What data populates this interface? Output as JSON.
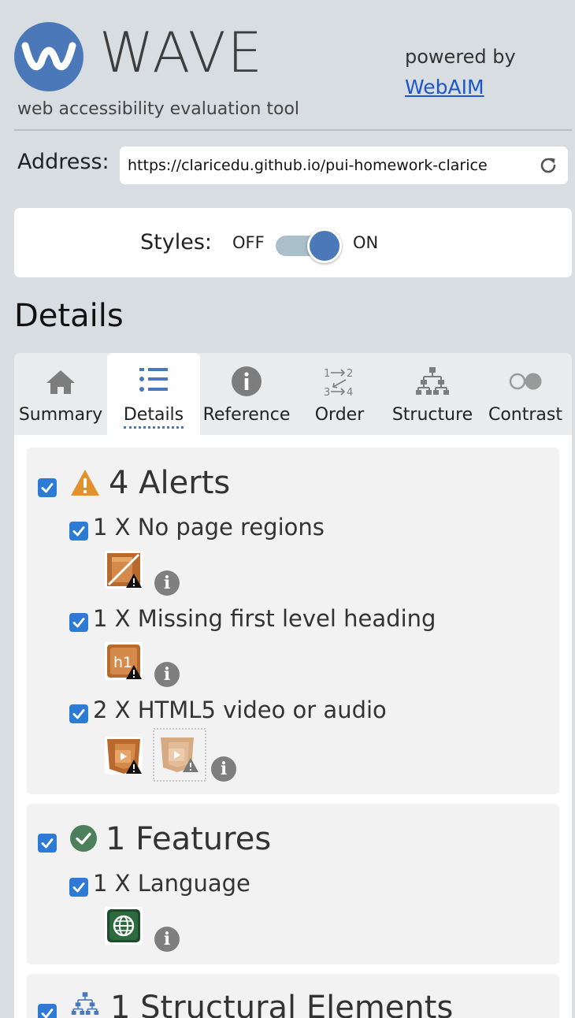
{
  "header": {
    "logo_word": "WAVE",
    "tagline": "web accessibility evaluation tool",
    "powered_by": "powered by",
    "webaim_link": "WebAIM"
  },
  "address": {
    "label": "Address:",
    "url": "https://claricedu.github.io/pui-homework-clarice"
  },
  "styles": {
    "label": "Styles:",
    "off": "OFF",
    "on": "ON",
    "state": "on"
  },
  "panel_title": "Details",
  "tabs": [
    {
      "label": "Summary",
      "icon": "home-icon"
    },
    {
      "label": "Details",
      "icon": "list-icon",
      "active": true
    },
    {
      "label": "Reference",
      "icon": "info-icon"
    },
    {
      "label": "Order",
      "icon": "order-icon"
    },
    {
      "label": "Structure",
      "icon": "structure-icon"
    },
    {
      "label": "Contrast",
      "icon": "contrast-icon"
    }
  ],
  "categories": [
    {
      "title": "4 Alerts",
      "icon": "alert-icon",
      "items": [
        {
          "label": "1 X No page regions",
          "icon": "no-regions-alert-icon"
        },
        {
          "label": "1 X Missing first level heading",
          "icon": "missing-h1-alert-icon",
          "icon_text": "h1"
        },
        {
          "label": "2 X HTML5 video or audio",
          "icon": "html5-video-alert-icon"
        }
      ]
    },
    {
      "title": "1 Features",
      "icon": "check-circle-icon",
      "items": [
        {
          "label": "1 X Language",
          "icon": "language-globe-icon"
        }
      ]
    },
    {
      "title": "1 Structural Elements",
      "icon": "structure-icon",
      "items": []
    }
  ],
  "colors": {
    "brand_blue": "#4a78b8",
    "alert_orange": "#e1912d",
    "feature_green": "#4e7f5d",
    "checkbox_blue": "#2e7bd6"
  }
}
